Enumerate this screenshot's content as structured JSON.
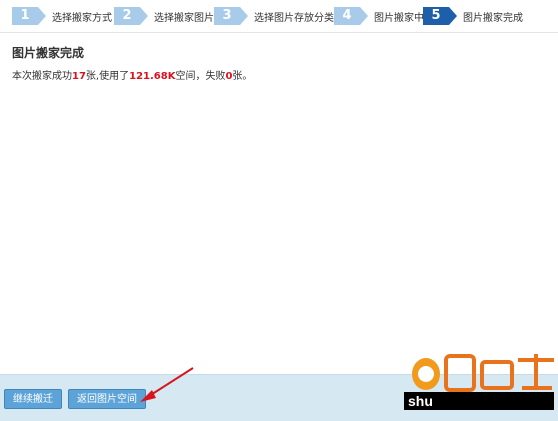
{
  "steps": [
    {
      "number": "1",
      "label": "选择搬家方式"
    },
    {
      "number": "2",
      "label": "选择搬家图片"
    },
    {
      "number": "3",
      "label": "选择图片存放分类"
    },
    {
      "number": "4",
      "label": "图片搬家中"
    },
    {
      "number": "5",
      "label": "图片搬家完成"
    }
  ],
  "title": "图片搬家完成",
  "summary": {
    "part1": "本次搬家成功",
    "count": "17",
    "part2": "张,使用了",
    "space": "121.68K",
    "part3": "空间，失败",
    "failed": "0",
    "part4": "张。"
  },
  "buttons": {
    "continue": "继续搬迁",
    "back": "返回图片空间"
  },
  "watermark": {
    "text": "shu"
  },
  "colors": {
    "active_step": "#1d5fa8",
    "inactive_step": "#a9cbea",
    "highlight": "#e0101a",
    "button": "#5da3d8",
    "footer": "#d6e8f2"
  }
}
